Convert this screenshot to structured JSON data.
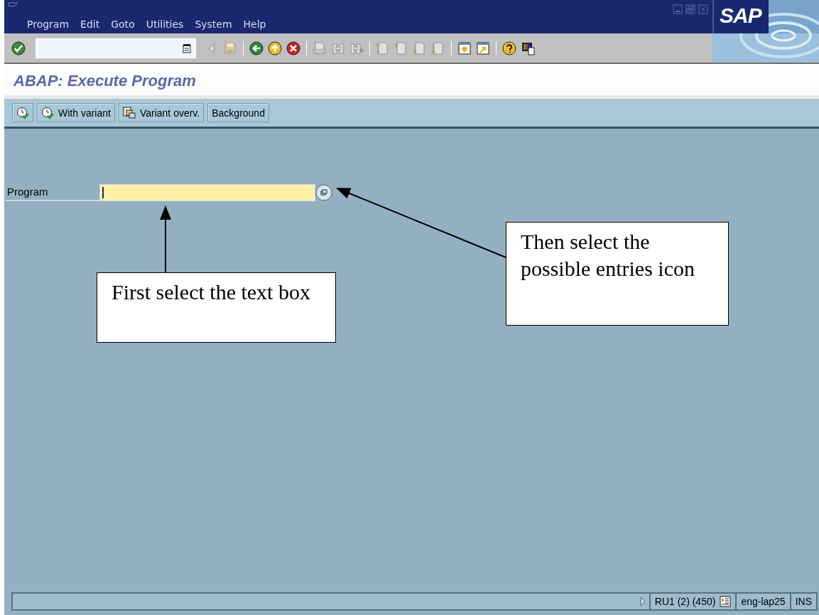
{
  "menu": [
    {
      "label": "Program"
    },
    {
      "label": "Edit"
    },
    {
      "label": "Goto"
    },
    {
      "label": "Utilities"
    },
    {
      "label": "System"
    },
    {
      "label": "Help"
    }
  ],
  "logo": "SAP",
  "title": "ABAP: Execute Program",
  "app_toolbar": [
    {
      "kind": "clock"
    },
    {
      "kind": "clock",
      "label": "With variant"
    },
    {
      "kind": "copy",
      "label": "Variant overv."
    },
    {
      "kind": "text",
      "label": "Background"
    }
  ],
  "form": {
    "fields": [
      {
        "label": "Program",
        "focused": true
      }
    ]
  },
  "annotations": [
    {
      "text": "First select the text box",
      "kind": "vertical"
    },
    {
      "text": "Then select the possible entries icon",
      "kind": "diagonal"
    }
  ],
  "status_bar": {
    "system": "RU1 (2) (450)",
    "server": "eng-lap25",
    "mode": "INS"
  }
}
